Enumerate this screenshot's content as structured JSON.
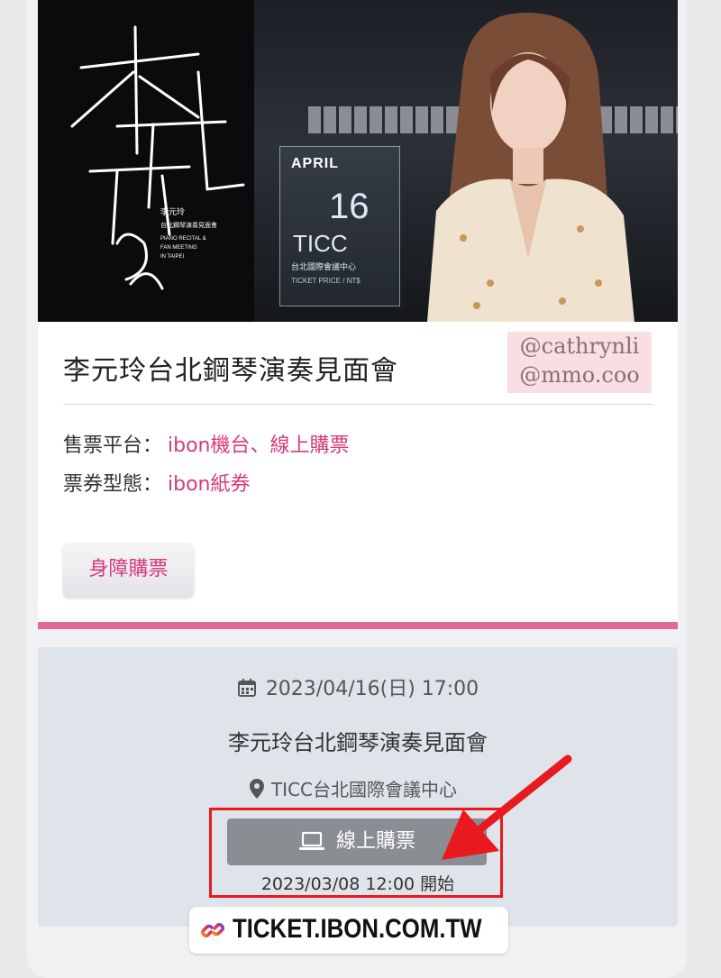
{
  "banner": {
    "month": "APRIL",
    "day": "16",
    "venue_en": "TICC",
    "venue_zh": "台北國際會議中心",
    "price_note": "TICKET PRICE / NT$",
    "artist_name_zh": "李元玲",
    "subtitle_zh": "台北鋼琴演奏見面會",
    "subtitle_en_1": "PIANO RECITAL &",
    "subtitle_en_2": "FAN MEETING",
    "subtitle_en_3": "IN TAIPEI"
  },
  "event": {
    "title": "李元玲台北鋼琴演奏見面會",
    "handles": [
      "@cathrynli",
      "@mmo.coo"
    ],
    "platform_label": "售票平台：",
    "platform_value": "ibon機台、線上購票",
    "ticket_type_label": "票券型態：",
    "ticket_type_value": "ibon紙券",
    "accessible_button": "身障購票"
  },
  "session": {
    "datetime": "2023/04/16(日) 17:00",
    "title": "李元玲台北鋼琴演奏見面會",
    "venue": "TICC台北國際會議中心",
    "buy_button": "線上購票",
    "open_time": "2023/03/08  12:00  開始"
  },
  "footer": {
    "url": "TICKET.IBON.COM.TW"
  },
  "colors": {
    "accent_pink": "#d63a7c",
    "divider_pink": "#e06a9a",
    "highlight_red": "#e8191f",
    "button_gray": "#8a8d92"
  },
  "icons": {
    "calendar": "calendar-icon",
    "location": "location-pin-icon",
    "buy": "laptop-icon",
    "link": "link-icon",
    "annotation": "red-arrow-icon"
  }
}
